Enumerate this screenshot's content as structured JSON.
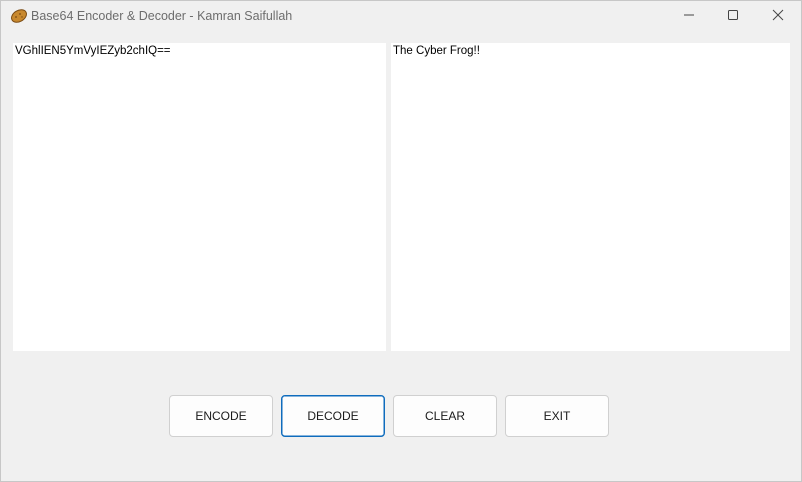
{
  "window": {
    "title": "Base64 Encoder & Decoder - Kamran Saifullah",
    "icon": "potato-icon"
  },
  "controls": {
    "minimize_icon": "minimize-icon",
    "maximize_icon": "maximize-icon",
    "close_icon": "close-icon"
  },
  "input_box": {
    "value": "VGhlIEN5YmVyIEZyb2chIQ=="
  },
  "output_box": {
    "value": "The Cyber Frog!!"
  },
  "buttons": {
    "encode": "ENCODE",
    "decode": "DECODE",
    "clear": "CLEAR",
    "exit": "EXIT"
  },
  "colors": {
    "focus_border": "#0f6cbd",
    "window_bg": "#f0f0f0"
  }
}
